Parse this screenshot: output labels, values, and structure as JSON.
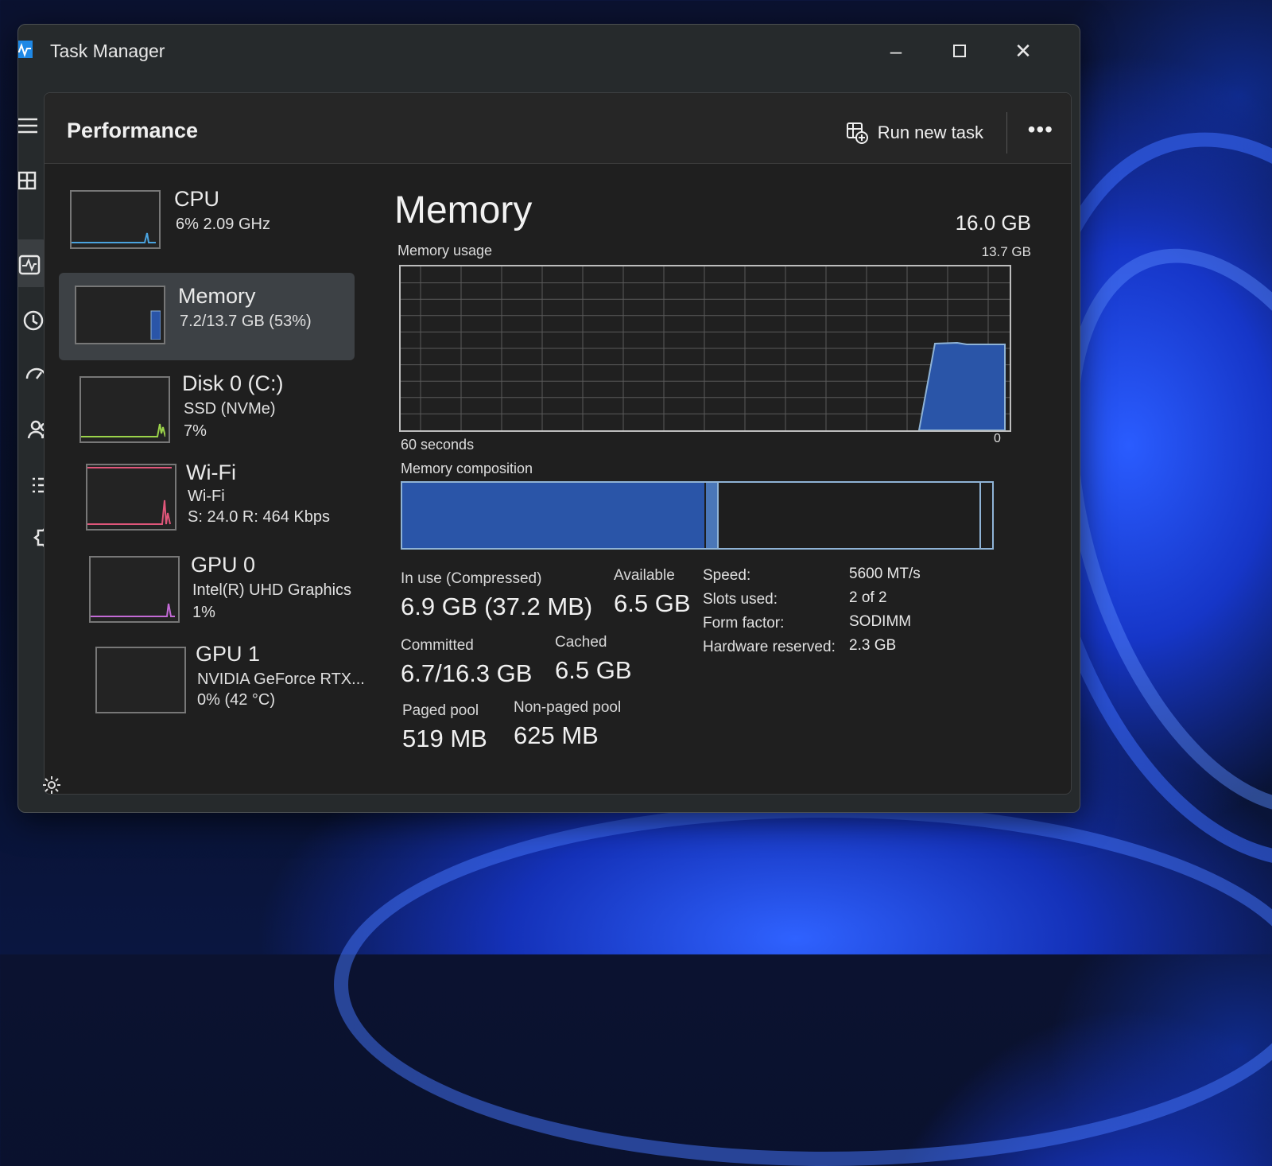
{
  "window": {
    "title": "Task Manager"
  },
  "header": {
    "title": "Performance",
    "run_new_task": "Run new task",
    "more": "•••"
  },
  "devices": [
    {
      "name": "CPU",
      "sub1": "6% 2.09 GHz",
      "sub2": ""
    },
    {
      "name": "Memory",
      "sub1": "7.2/13.7 GB (53%)",
      "sub2": ""
    },
    {
      "name": "Disk 0 (C:)",
      "sub1": "SSD (NVMe)",
      "sub2": "7%"
    },
    {
      "name": "Wi-Fi",
      "sub1": "Wi-Fi",
      "sub2": "S: 24.0 R: 464 Kbps"
    },
    {
      "name": "GPU 0",
      "sub1": "Intel(R) UHD Graphics",
      "sub2": "1%"
    },
    {
      "name": "GPU 1",
      "sub1": "NVIDIA GeForce RTX...",
      "sub2": "0% (42 °C)"
    }
  ],
  "memory": {
    "title": "Memory",
    "total": "16.0 GB",
    "usage_label": "Memory usage",
    "usage_max": "13.7 GB",
    "seconds": "60 seconds",
    "zero": "0",
    "composition_label": "Memory composition",
    "in_use_label": "In use (Compressed)",
    "in_use_value": "6.9 GB (37.2 MB)",
    "available_label": "Available",
    "available_value": "6.5 GB",
    "committed_label": "Committed",
    "committed_value": "6.7/16.3 GB",
    "cached_label": "Cached",
    "cached_value": "6.5 GB",
    "paged_label": "Paged pool",
    "paged_value": "519 MB",
    "nonpaged_label": "Non-paged pool",
    "nonpaged_value": "625 MB",
    "speed_label": "Speed:",
    "speed_value": "5600 MT/s",
    "slots_label": "Slots used:",
    "slots_value": "2 of 2",
    "form_label": "Form factor:",
    "form_value": "SODIMM",
    "hw_label": "Hardware reserved:",
    "hw_value": "2.3 GB"
  },
  "colors": {
    "memory_accent": "#2a55a8",
    "memory_line": "#8fb3d6"
  }
}
